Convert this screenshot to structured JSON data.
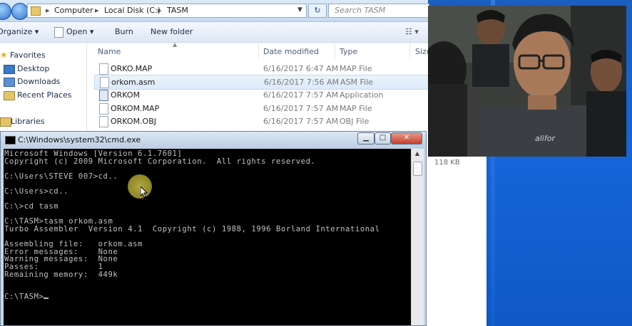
{
  "explorer": {
    "breadcrumb": [
      "Computer",
      "Local Disk (C:)",
      "TASM"
    ],
    "search_placeholder": "Search TASM",
    "toolbar": {
      "organize": "Organize ▾",
      "open": "Open ▾",
      "burn": "Burn",
      "new_folder": "New folder"
    },
    "sidebar": {
      "favorites": "Favorites",
      "items": [
        "Desktop",
        "Downloads",
        "Recent Places"
      ],
      "libraries": "Libraries"
    },
    "columns": {
      "name": "Name",
      "date": "Date modified",
      "type": "Type",
      "size": "Size"
    },
    "files": [
      {
        "name": "ORKO.MAP",
        "date": "6/16/2017 6:47 AM",
        "type": "MAP File",
        "selected": false
      },
      {
        "name": "orkom.asm",
        "date": "6/16/2017 7:56 AM",
        "type": "ASM File",
        "selected": true
      },
      {
        "name": "ORKOM",
        "date": "6/16/2017 7:57 AM",
        "type": "Application",
        "selected": false
      },
      {
        "name": "ORKOM.MAP",
        "date": "6/16/2017 7:57 AM",
        "type": "MAP File",
        "selected": false
      },
      {
        "name": "ORKOM.OBJ",
        "date": "6/16/2017 7:57 AM",
        "type": "OBJ File",
        "selected": false
      }
    ],
    "size_visible": "118 KB"
  },
  "cmd": {
    "title": "C:\\Windows\\system32\\cmd.exe",
    "buttons": {
      "minimize": "▁",
      "maximize": "□",
      "close": "✕"
    },
    "lines": [
      "Microsoft Windows [Version 6.1.7601]",
      "Copyright (c) 2009 Microsoft Corporation.  All rights reserved.",
      "",
      "C:\\Users\\STEVE 007>cd..",
      "",
      "C:\\Users>cd..",
      "",
      "C:\\>cd tasm",
      "",
      "C:\\TASM>tasm orkom.asm",
      "Turbo Assembler  Version 4.1  Copyright (c) 1988, 1996 Borland International",
      "",
      "Assembling file:   orkom.asm",
      "Error messages:    None",
      "Warning messages:  None",
      "Passes:            1",
      "Remaining memory:  449k",
      "",
      "",
      "C:\\TASM>"
    ]
  },
  "colors": {
    "console_bg": "#000000",
    "console_fg": "#c0c0c0",
    "desktop": "#1565d8",
    "selection": "#dceafb"
  }
}
